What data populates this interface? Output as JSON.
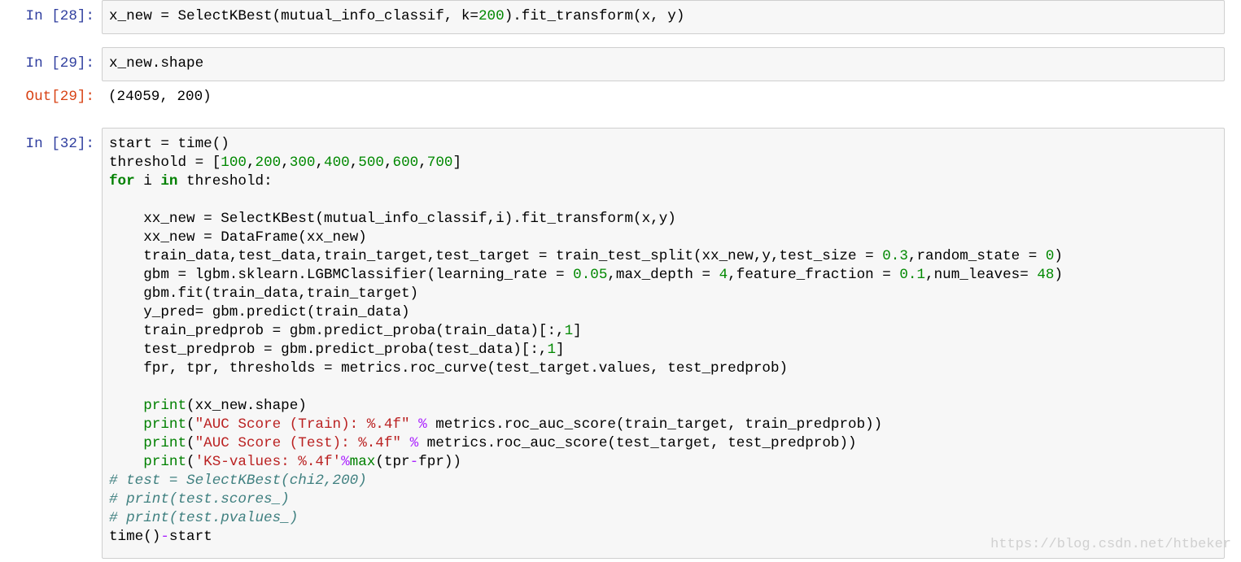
{
  "cells": [
    {
      "prompt": "In [28]:",
      "lines": [
        [
          [
            "x_new = SelectKBest(mutual_info_classif, k=",
            "t"
          ],
          [
            "200",
            "num"
          ],
          [
            ").fit_transform(x, y)",
            "t"
          ]
        ]
      ]
    },
    {
      "prompt": "In [29]:",
      "lines": [
        [
          [
            "x_new.shape",
            "t"
          ]
        ]
      ],
      "output_prompt": "Out[29]:",
      "output": "(24059, 200)"
    },
    {
      "prompt": "In [32]:",
      "lines": [
        [
          [
            "start = time()",
            "t"
          ]
        ],
        [
          [
            "threshold = [",
            "t"
          ],
          [
            "100",
            "num"
          ],
          [
            ",",
            "t"
          ],
          [
            "200",
            "num"
          ],
          [
            ",",
            "t"
          ],
          [
            "300",
            "num"
          ],
          [
            ",",
            "t"
          ],
          [
            "400",
            "num"
          ],
          [
            ",",
            "t"
          ],
          [
            "500",
            "num"
          ],
          [
            ",",
            "t"
          ],
          [
            "600",
            "num"
          ],
          [
            ",",
            "t"
          ],
          [
            "700",
            "num"
          ],
          [
            "]",
            "t"
          ]
        ],
        [
          [
            "for",
            "kw"
          ],
          [
            " i ",
            "t"
          ],
          [
            "in",
            "kw"
          ],
          [
            " threshold:",
            "t"
          ]
        ],
        [],
        [
          [
            "    xx_new = SelectKBest(mutual_info_classif,i).fit_transform(x,y)",
            "t"
          ]
        ],
        [
          [
            "    xx_new = DataFrame(xx_new)",
            "t"
          ]
        ],
        [
          [
            "    train_data,test_data,train_target,test_target = train_test_split(xx_new,y,test_size = ",
            "t"
          ],
          [
            "0.3",
            "num"
          ],
          [
            ",random_state = ",
            "t"
          ],
          [
            "0",
            "num"
          ],
          [
            ")",
            "t"
          ]
        ],
        [
          [
            "    gbm = lgbm.sklearn.LGBMClassifier(learning_rate = ",
            "t"
          ],
          [
            "0.05",
            "num"
          ],
          [
            ",max_depth = ",
            "t"
          ],
          [
            "4",
            "num"
          ],
          [
            ",feature_fraction = ",
            "t"
          ],
          [
            "0.1",
            "num"
          ],
          [
            ",num_leaves= ",
            "t"
          ],
          [
            "48",
            "num"
          ],
          [
            ")",
            "t"
          ]
        ],
        [
          [
            "    gbm.fit(train_data,train_target)",
            "t"
          ]
        ],
        [
          [
            "    y_pred= gbm.predict(train_data)",
            "t"
          ]
        ],
        [
          [
            "    train_predprob = gbm.predict_proba(train_data)[:,",
            "t"
          ],
          [
            "1",
            "num"
          ],
          [
            "]",
            "t"
          ]
        ],
        [
          [
            "    test_predprob = gbm.predict_proba(test_data)[:,",
            "t"
          ],
          [
            "1",
            "num"
          ],
          [
            "]",
            "t"
          ]
        ],
        [
          [
            "    fpr, tpr, thresholds = metrics.roc_curve(test_target.values, test_predprob)",
            "t"
          ]
        ],
        [],
        [
          [
            "    ",
            "t"
          ],
          [
            "print",
            "kwn"
          ],
          [
            "(xx_new.shape)",
            "t"
          ]
        ],
        [
          [
            "    ",
            "t"
          ],
          [
            "print",
            "kwn"
          ],
          [
            "(",
            "t"
          ],
          [
            "\"AUC Score (Train): %.4f\"",
            "str"
          ],
          [
            " ",
            "t"
          ],
          [
            "%",
            "op"
          ],
          [
            " metrics.roc_auc_score(train_target, train_predprob))",
            "t"
          ]
        ],
        [
          [
            "    ",
            "t"
          ],
          [
            "print",
            "kwn"
          ],
          [
            "(",
            "t"
          ],
          [
            "\"AUC Score (Test): %.4f\"",
            "str"
          ],
          [
            " ",
            "t"
          ],
          [
            "%",
            "op"
          ],
          [
            " metrics.roc_auc_score(test_target, test_predprob))",
            "t"
          ]
        ],
        [
          [
            "    ",
            "t"
          ],
          [
            "print",
            "kwn"
          ],
          [
            "(",
            "t"
          ],
          [
            "'KS-values: %.4f'",
            "str"
          ],
          [
            "%",
            "op"
          ],
          [
            "max",
            "kwn"
          ],
          [
            "(tpr",
            "t"
          ],
          [
            "-",
            "op"
          ],
          [
            "fpr))",
            "t"
          ]
        ],
        [
          [
            "# test = SelectKBest(chi2,200)",
            "cmt"
          ]
        ],
        [
          [
            "# print(test.scores_)",
            "cmt"
          ]
        ],
        [
          [
            "# print(test.pvalues_)",
            "cmt"
          ]
        ],
        [
          [
            "time()",
            "t"
          ],
          [
            "-",
            "op"
          ],
          [
            "start",
            "t"
          ]
        ]
      ]
    }
  ],
  "watermark": "https://blog.csdn.net/htbeker",
  "colors": {
    "in_prompt": "#303f9f",
    "out_prompt": "#d84315",
    "number": "#008800",
    "keyword": "#008000",
    "string": "#ba2121",
    "operator": "#aa22ff",
    "comment": "#408080",
    "cell_bg": "#f7f7f7",
    "cell_border": "#cfcfcf"
  }
}
